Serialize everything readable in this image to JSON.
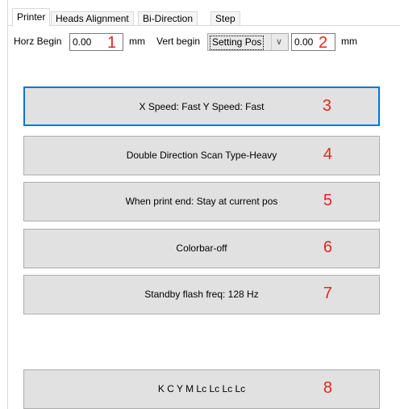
{
  "tabs": [
    "Printer",
    "Heads Alignment",
    "Bi-Direction",
    "Step"
  ],
  "horz": {
    "label": "Horz Begin",
    "value": "0.00",
    "unit": "mm",
    "marker": "1"
  },
  "vert": {
    "label": "Vert begin",
    "mode": "Setting Pos",
    "arrow": "∨",
    "value": "0.00",
    "unit": "mm",
    "marker": "2"
  },
  "buttons": [
    {
      "label": "X Speed:  Fast   Y Speed:  Fast",
      "marker": "3"
    },
    {
      "label": "Double Direction Scan   Type-Heavy",
      "marker": "4"
    },
    {
      "label": "When print end:    Stay at current pos",
      "marker": "5"
    },
    {
      "label": "Colorbar-off",
      "marker": "6"
    },
    {
      "label": "Standby flash freq:  128 Hz",
      "marker": "7"
    },
    {
      "label": "K    C    Y    M    Lc    Lc    Lc    Lc",
      "marker": "8"
    }
  ],
  "colors": {
    "accent": "#0078d7",
    "marker": "#e0271d",
    "button": "#e1e1e1"
  }
}
